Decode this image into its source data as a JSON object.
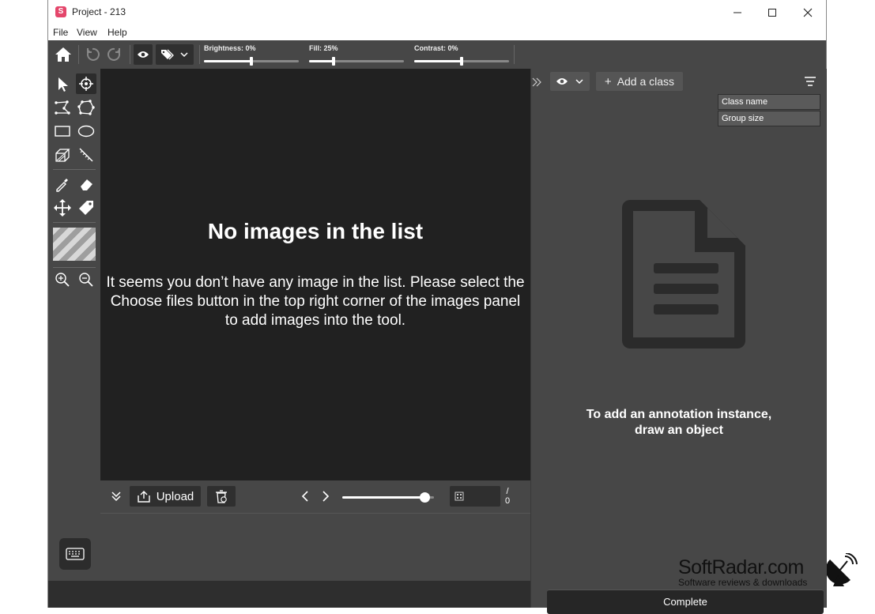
{
  "window": {
    "title": "Project - 213",
    "app_icon_letter": "S"
  },
  "menu": [
    "File",
    "View",
    "Help"
  ],
  "sliders": [
    {
      "label": "Brightness: 0%",
      "value": 0.5
    },
    {
      "label": "Fill: 25%",
      "value": 0.26
    },
    {
      "label": "Contrast: 0%",
      "value": 0.5
    }
  ],
  "canvas": {
    "title": "No images in the list",
    "message": "It seems you don’t have any image in the list. Please select the Choose files button in the top right corner of the images panel to add images into the tool."
  },
  "bottombar": {
    "upload_label": "Upload",
    "page_total_top": "/",
    "page_total_bottom": "0",
    "zoom_value": 0.9
  },
  "panel": {
    "add_class_label": "Add a class",
    "sort_options": [
      "Class name",
      "Group size"
    ],
    "empty_message_line1": "To add an annotation instance,",
    "empty_message_line2": "draw an object",
    "complete_label": "Complete"
  },
  "watermark": {
    "brand": "SoftRadar.com",
    "tagline": "Software reviews & downloads"
  },
  "colors": {
    "app_icon": "#e4466b",
    "canvas_bg": "#212121",
    "panel_bg": "#474747"
  }
}
